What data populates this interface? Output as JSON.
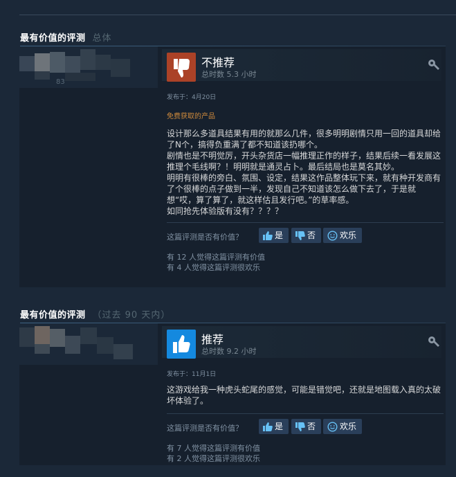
{
  "sections": [
    {
      "title": "最有价值的评测",
      "subtitle": "总体"
    },
    {
      "title": "最有价值的评测",
      "subtitle": "（过去 90 天内）"
    }
  ],
  "reviews": [
    {
      "author_number": "83",
      "verdict": "不推荐",
      "verdict_color": "#a34c25",
      "hours": "总时数 5.3 小时",
      "posted": "发布于：4月20日",
      "free_label": "免费获取的产品",
      "paragraphs": [
        "设计那么多道具结果有用的就那么几件，很多明明剧情只用一回的道具却给了N个，搞得负重满了都不知道该扔哪个。",
        "剧情也是不明觉厉，开头杂货店一幅推理正作的样子，结果后续一看发展这推理个毛线啊？！明明就是通灵占卜。最后结局也是莫名其妙。",
        "明明有很棒的旁白、氛围、设定，结果这作品整体玩下来，就有种开发商有了个很棒的点子做到一半，发现自己不知道该怎么做下去了，于是就想“哎，算了算了，就这样估且发行吧。”的草率感。",
        "如同抢先体验版有没有？？？？"
      ],
      "helpful_question": "这篇评测是否有价值？",
      "btn_yes": "是",
      "btn_no": "否",
      "btn_funny": "欢乐",
      "helpful_count": "有 12 人觉得这篇评测有价值",
      "funny_count": "有 4 人觉得这篇评测很欢乐"
    },
    {
      "verdict": "推荐",
      "verdict_color": "#1a9fff",
      "hours": "总时数 9.2 小时",
      "posted": "发布于：11月1日",
      "paragraphs": [
        "这游戏给我一种虎头蛇尾的感觉，可能是错觉吧，还就是地图载入真的太破坏体验了。"
      ],
      "helpful_question": "这篇评测是否有价值？",
      "btn_yes": "是",
      "btn_no": "否",
      "btn_funny": "欢乐",
      "helpful_count": "有 7 人觉得这篇评测有价值",
      "funny_count": "有 2 人觉得这篇评测很欢乐"
    }
  ],
  "icons": {
    "thumb_down": "thumbs-down-icon",
    "thumb_up": "thumbs-up-icon",
    "wrench": "wrench-icon",
    "funny": "smiley-icon"
  }
}
